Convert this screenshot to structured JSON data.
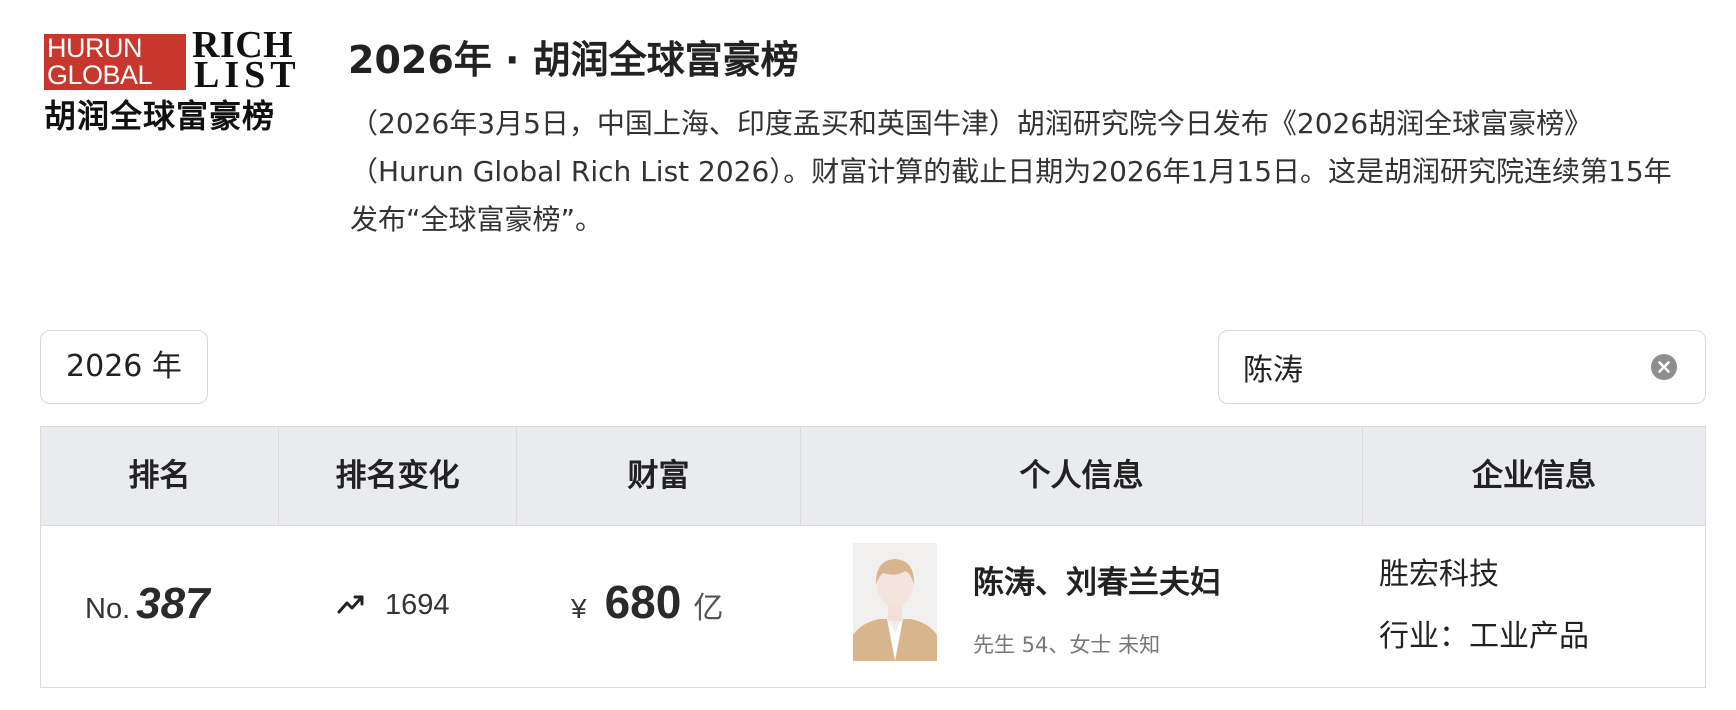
{
  "logo": {
    "line1": "HURUN",
    "line2": "GLOBAL",
    "line3": "RICH",
    "line4": "LIST",
    "chinese": "胡润全球富豪榜"
  },
  "header": {
    "title": "2026年 · 胡润全球富豪榜",
    "description": "（2026年3月5日，中国上海、印度孟买和英国牛津）胡润研究院今日发布《2026胡润全球富豪榜》（Hurun Global Rich List 2026）。财富计算的截止日期为2026年1月15日。这是胡润研究院连续第15年发布“全球富豪榜”。"
  },
  "controls": {
    "year_selected": "2026 年",
    "search_value": "陈涛",
    "clear_icon": "close-circle-icon"
  },
  "table": {
    "columns": [
      "排名",
      "排名变化",
      "财富",
      "个人信息",
      "企业信息"
    ],
    "rows": [
      {
        "rank_prefix": "No.",
        "rank": "387",
        "rank_change_icon": "trending-up-icon",
        "rank_change": "1694",
        "currency": "¥",
        "wealth": "680",
        "wealth_unit": "亿",
        "avatar_icon": "person-avatar",
        "name": "陈涛、刘春兰夫妇",
        "detail": "先生  54、女士  未知",
        "company": "胜宏科技",
        "industry": "行业：工业产品"
      }
    ]
  },
  "colors": {
    "brand_red": "#c8372d",
    "header_bg": "#e9ebef",
    "border": "#dcdcdc"
  }
}
